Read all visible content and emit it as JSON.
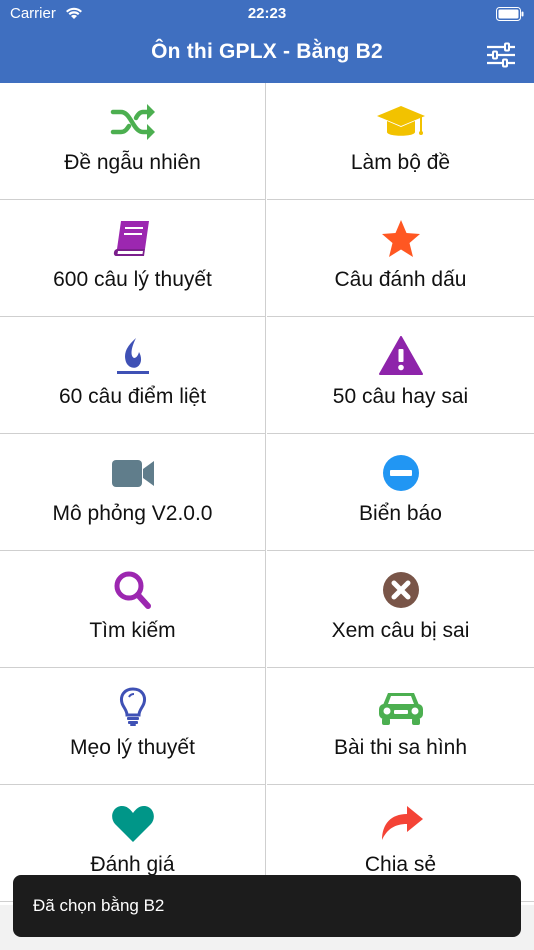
{
  "status": {
    "carrier": "Carrier",
    "time": "22:23"
  },
  "header": {
    "title": "Ôn thi GPLX - Bằng B2"
  },
  "menu": [
    {
      "label": "Đề ngẫu nhiên",
      "icon": "shuffle-icon",
      "color": "#4caf50"
    },
    {
      "label": "Làm bộ đề",
      "icon": "graduation-cap-icon",
      "color": "#f2c200"
    },
    {
      "label": "600 câu lý thuyết",
      "icon": "book-icon",
      "color": "#9c27b0"
    },
    {
      "label": "Câu đánh dấu",
      "icon": "star-icon",
      "color": "#ff5722"
    },
    {
      "label": "60 câu điểm liệt",
      "icon": "fire-icon",
      "color": "#3f51b5"
    },
    {
      "label": "50 câu hay sai",
      "icon": "warning-icon",
      "color": "#8e24aa"
    },
    {
      "label": "Mô phỏng V2.0.0",
      "icon": "video-camera-icon",
      "color": "#607d8b"
    },
    {
      "label": "Biển báo",
      "icon": "no-entry-icon",
      "color": "#2196f3"
    },
    {
      "label": "Tìm kiếm",
      "icon": "search-icon",
      "color": "#9c27b0"
    },
    {
      "label": "Xem câu bị sai",
      "icon": "times-circle-icon",
      "color": "#795548"
    },
    {
      "label": "Mẹo lý thuyết",
      "icon": "lightbulb-icon",
      "color": "#3f51b5"
    },
    {
      "label": "Bài thi sa hình",
      "icon": "car-icon",
      "color": "#4caf50"
    },
    {
      "label": "Đánh giá",
      "icon": "heart-icon",
      "color": "#009688"
    },
    {
      "label": "Chia sẻ",
      "icon": "share-icon",
      "color": "#f44336"
    }
  ],
  "toast": {
    "text": "Đã chọn bằng B2"
  }
}
